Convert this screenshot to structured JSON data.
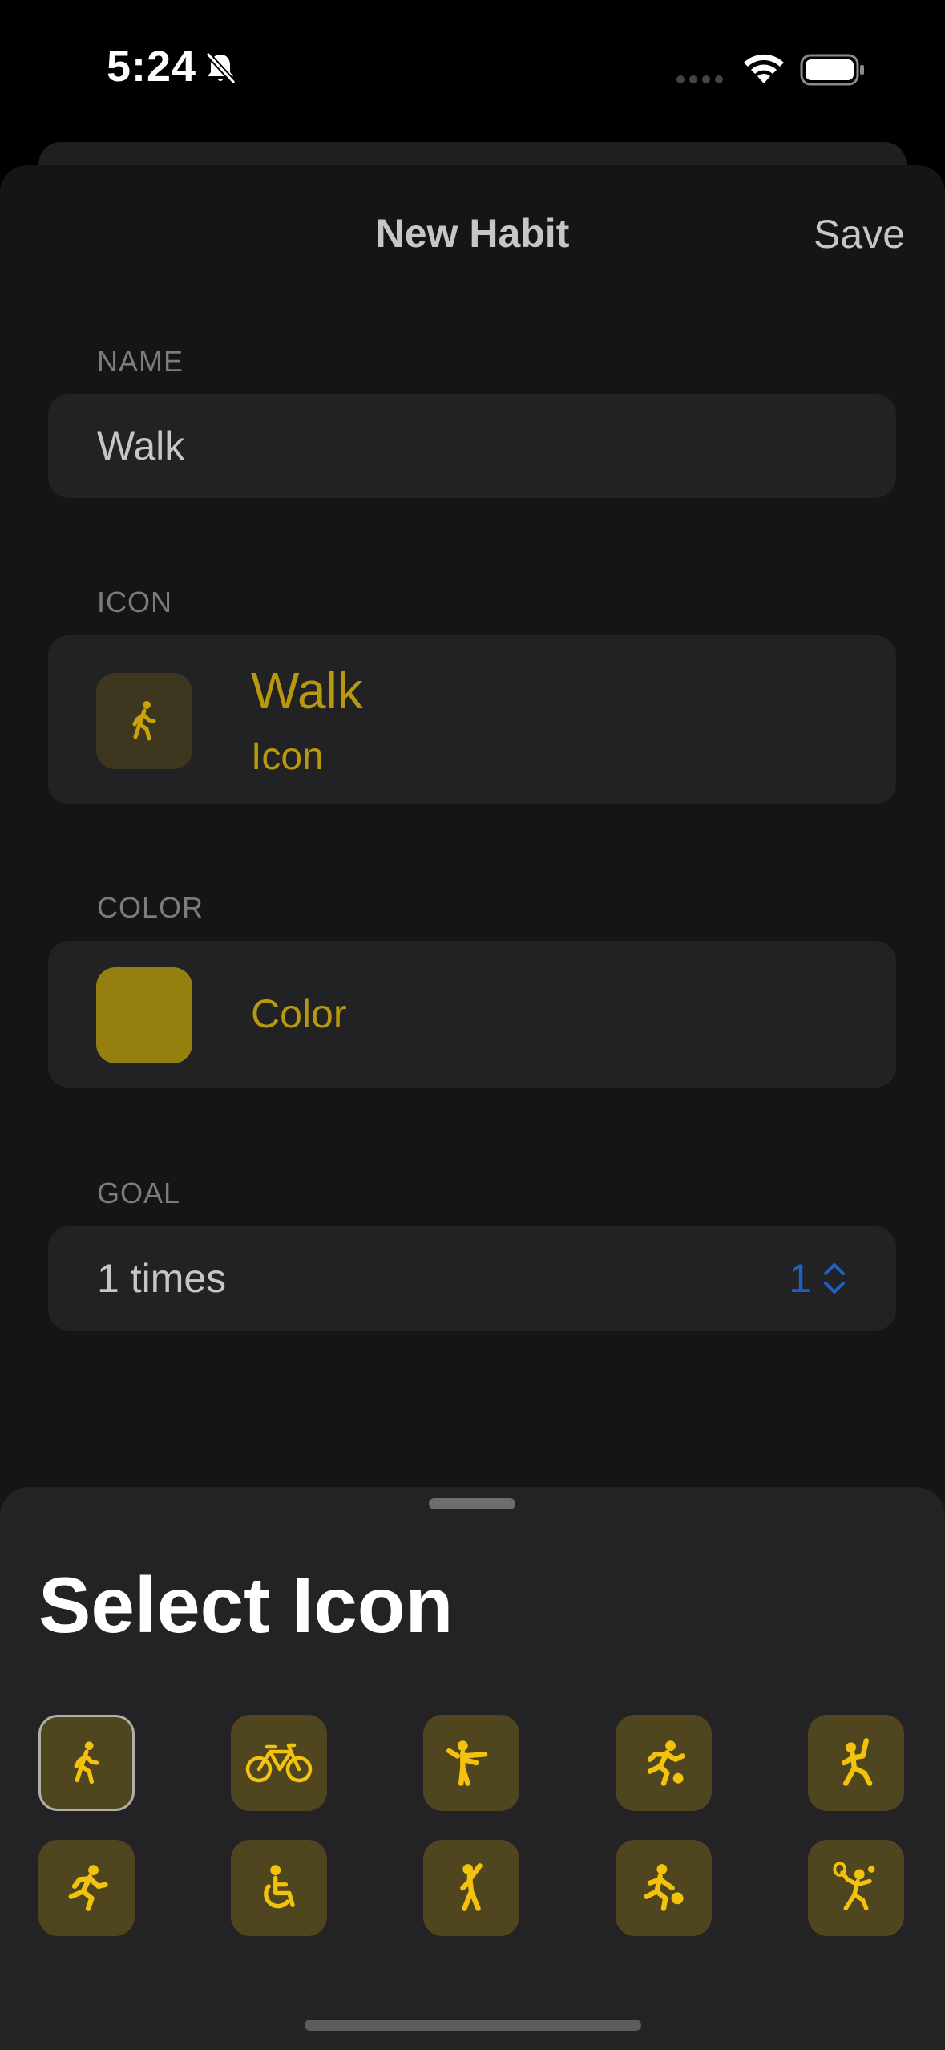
{
  "status_bar": {
    "time": "5:24",
    "icons": [
      "bell-slash-icon",
      "cellular-signal-icon",
      "wifi-icon",
      "battery-icon"
    ]
  },
  "nav": {
    "title": "New Habit",
    "save_label": "Save"
  },
  "form": {
    "name_section": {
      "label": "NAME",
      "value": "Walk"
    },
    "icon_section": {
      "label": "ICON",
      "title": "Walk",
      "subtitle": "Icon",
      "icon": "figure-walk-icon"
    },
    "color_section": {
      "label": "COLOR",
      "text": "Color",
      "swatch_color": "#95800f"
    },
    "goal_section": {
      "label": "GOAL",
      "text": "1 times",
      "stepper_value": "1"
    }
  },
  "icon_picker": {
    "title": "Select Icon",
    "options": [
      "figure-walk-icon",
      "bicycle-icon",
      "martial-arts-icon",
      "soccer-icon",
      "baseball-icon",
      "figure-run-icon",
      "wheelchair-icon",
      "dance-icon",
      "basketball-icon",
      "tennis-icon"
    ],
    "selected_index": 0
  },
  "colors": {
    "accent": "#b8990e",
    "icon_glyph": "#f2c20c",
    "stepper": "#1c62c4",
    "tile": "#4f4620"
  }
}
